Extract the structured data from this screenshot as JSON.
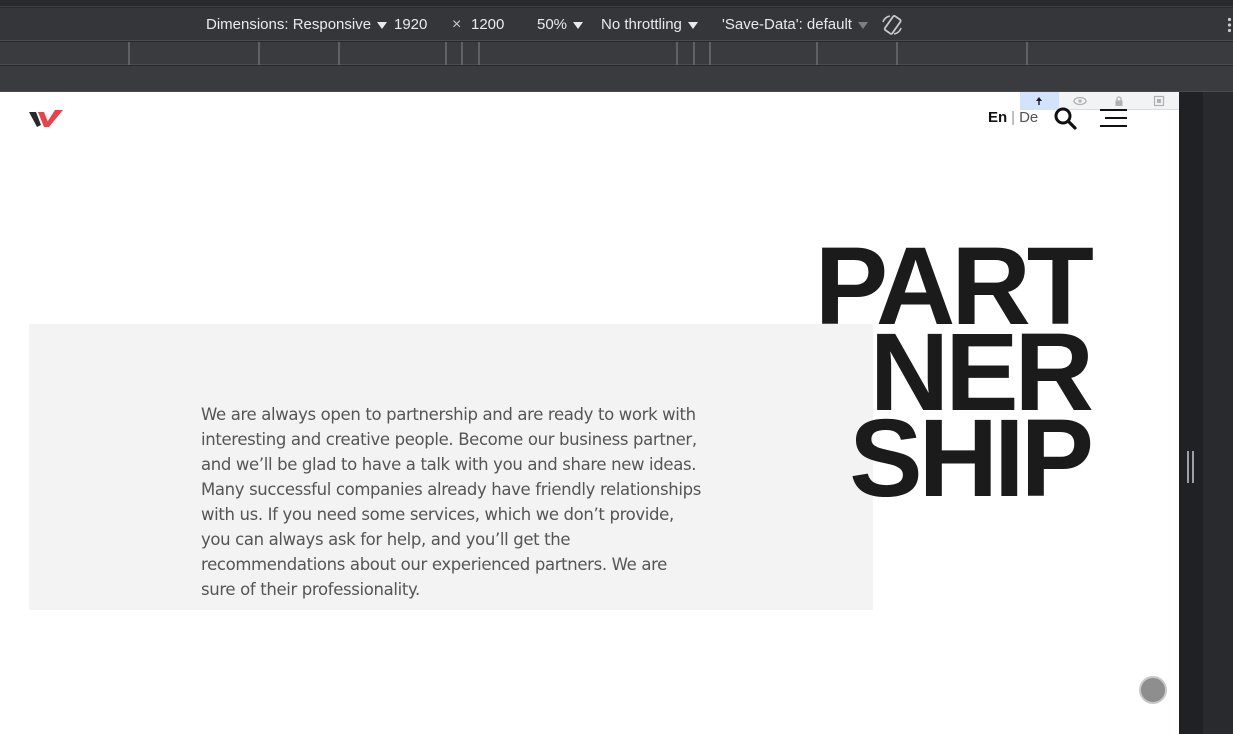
{
  "devtools": {
    "dimensions_label": "Dimensions: Responsive",
    "width": "1920",
    "times": "×",
    "height": "1200",
    "zoom": "50%",
    "throttling": "No throttling",
    "save_data": "'Save-Data': default",
    "icons": [
      "rotate-icon",
      "more-options-icon"
    ]
  },
  "page": {
    "lang_active": "En",
    "lang_sep": "|",
    "lang_other": "De",
    "headline_lines": [
      "PART",
      "NER",
      "SHIP"
    ],
    "body_text": "We are always open to partnership and are ready to work with interesting and creative people. Become our business partner, and we’ll be glad to have a talk with you and share new ideas. Many successful companies already have friendly relationships with us. If you need some services, which we don’t provide, you can always ask for help, and you’ll get the recommendations about our experienced partners. We are sure of their professionality.",
    "colors": {
      "logo_dark": "#2a2a2a",
      "logo_accent": "#e8434b",
      "headline": "#1b1b1b",
      "panel": "#f3f3f3"
    }
  }
}
